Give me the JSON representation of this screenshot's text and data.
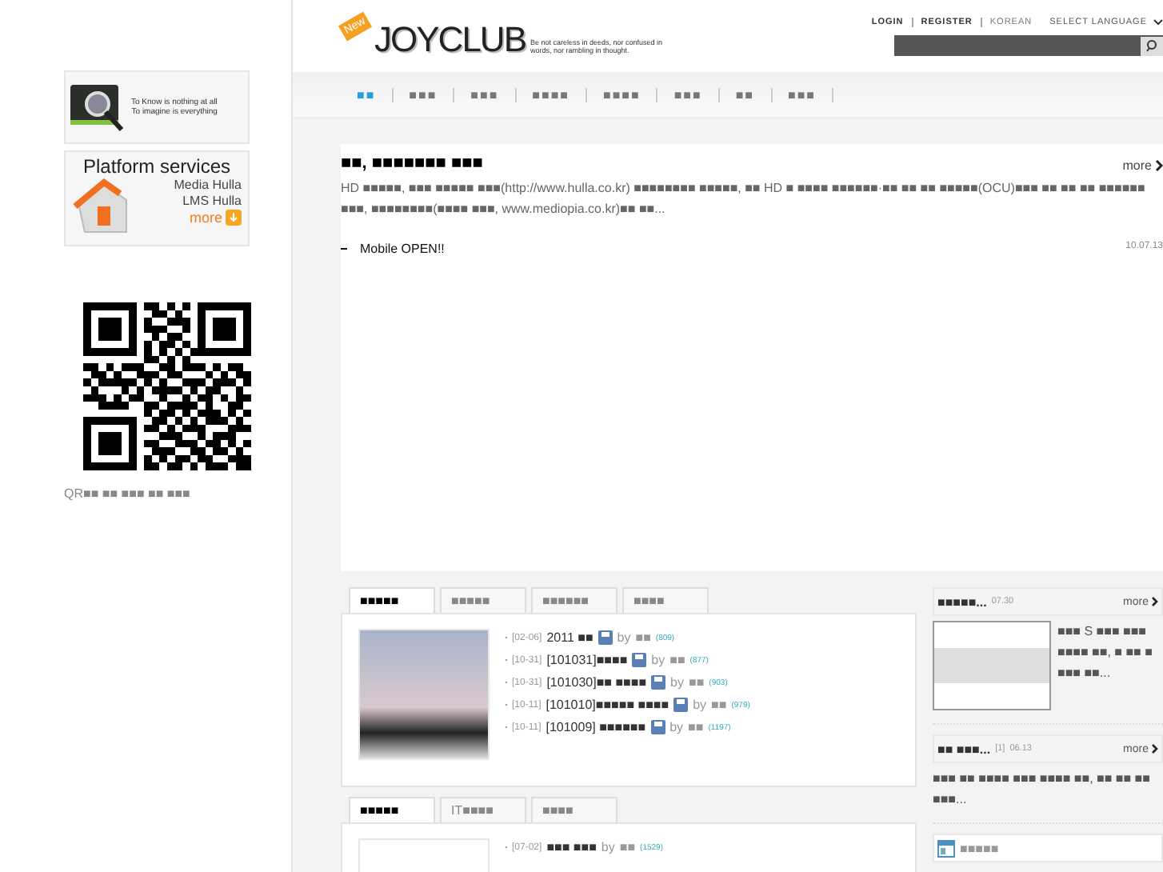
{
  "header": {
    "logo_badge": "New",
    "logo": "JOYCLUB",
    "tagline": "Be not careless in deeds, nor confused in words, nor rambling in thought.",
    "links": [
      "LOGIN",
      "REGISTER",
      "KOREAN"
    ],
    "language_select": "SELECT LANGUAGE"
  },
  "nav": [
    {
      "label": "■■",
      "selected": true
    },
    {
      "label": "■■■",
      "selected": false
    },
    {
      "label": "■■■",
      "selected": false
    },
    {
      "label": "■■■■",
      "selected": false
    },
    {
      "label": "■■■■",
      "selected": false
    },
    {
      "label": "■■■",
      "selected": false
    },
    {
      "label": "■■",
      "selected": false
    },
    {
      "label": "■■■",
      "selected": false
    }
  ],
  "sidebar": {
    "banner_1": {
      "lines": [
        "To Know is nothing at all",
        "To imagine is everything"
      ]
    },
    "banner_2": {
      "title": "Platform services",
      "lines": [
        "Media Hulla",
        "LMS Hulla"
      ],
      "more": "more"
    },
    "qr_caption": "QR■■ ■■ ■■■ ■■ ■■■"
  },
  "notice": {
    "title": "■■, ■■■■■■■ ■■■",
    "more": "more",
    "body": "HD ■■■■■, ■■■ ■■■■■ ■■■(http://www.hulla.co.kr) ■■■■■■■■ ■■■■■, ■■ HD ■ ■■■■ ■■■■■■·■■ ■■ ■■ ■■■■■(OCU)■■■ ■■ ■■ ■■ ■■■■■■ ■■■, ■■■■■■■■(■■■■ ■■■, www.mediopia.co.kr)■■ ■■...",
    "items": [
      {
        "title": "Mobile OPEN!!",
        "date": "10.07.13"
      }
    ]
  },
  "board_1": {
    "tabs": [
      {
        "label": "■■■■■",
        "selected": true
      },
      {
        "label": "■■■■■",
        "selected": false
      },
      {
        "label": "■■■■■■",
        "selected": false
      },
      {
        "label": "■■■■",
        "selected": false
      }
    ],
    "posts": [
      {
        "date": "[02-06]",
        "title": "2011 ■■",
        "by": "by",
        "author": "■■",
        "count": "(809)"
      },
      {
        "date": "[10-31]",
        "title": "[101031]■■■■",
        "by": "by",
        "author": "■■",
        "count": "(877)"
      },
      {
        "date": "[10-31]",
        "title": "[101030]■■ ■■■■",
        "by": "by",
        "author": "■■",
        "count": "(903)"
      },
      {
        "date": "[10-11]",
        "title": "[101010]■■■■■ ■■■■",
        "by": "by",
        "author": "■■",
        "count": "(979)"
      },
      {
        "date": "[10-11]",
        "title": "[101009] ■■■■■■",
        "by": "by",
        "author": "■■",
        "count": "(1197)"
      }
    ]
  },
  "board_2": {
    "tabs": [
      {
        "label": "■■■■■",
        "selected": true
      },
      {
        "label": "IT■■■■",
        "selected": false
      },
      {
        "label": "■■■■",
        "selected": false
      }
    ],
    "posts": [
      {
        "date": "[07-02]",
        "title": "■■■ ■■■",
        "by": "by",
        "author": "■■",
        "count": "(1529)"
      }
    ]
  },
  "widgets": [
    {
      "title": "■■■■■...",
      "date": "07.30",
      "more": "more",
      "text": "■■■ S ■■■ ■■■ ■■■■ ■■, ■ ■■ ■ ■■■ ■■..."
    },
    {
      "title": "■■ ■■■...",
      "index": "[1]",
      "date": "06.13",
      "more": "more",
      "text": "■■■ ■■ ■■■■ ■■■ ■■■■ ■■, ■■ ■■ ■■ ■■■..."
    }
  ],
  "calendar_widget": {
    "title": "■■■■■"
  }
}
